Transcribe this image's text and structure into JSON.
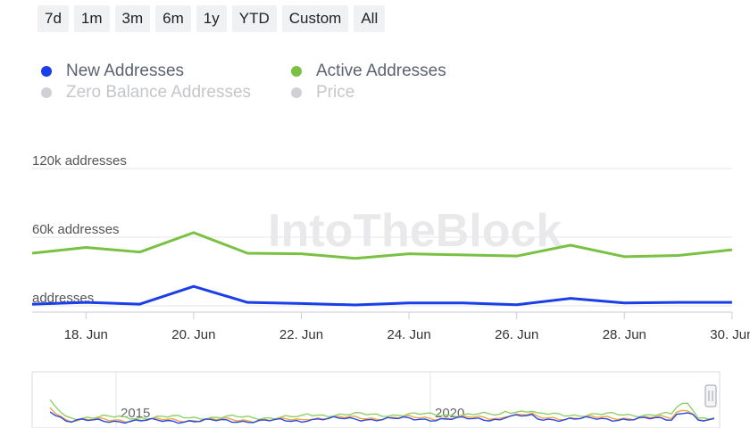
{
  "range_selector": {
    "buttons": [
      "7d",
      "1m",
      "3m",
      "6m",
      "1y",
      "YTD",
      "Custom",
      "All"
    ]
  },
  "legend": {
    "items": [
      {
        "label": "New Addresses",
        "color": "#1a3ee8",
        "active": true
      },
      {
        "label": "Active Addresses",
        "color": "#7ac143",
        "active": true
      },
      {
        "label": "Zero Balance Addresses",
        "color": "#cfd1d4",
        "active": false
      },
      {
        "label": "Price",
        "color": "#cfd1d4",
        "active": false
      }
    ]
  },
  "watermark": "IntoTheBlock",
  "chart_data": {
    "type": "line",
    "x": [
      "17. Jun",
      "18. Jun",
      "19. Jun",
      "20. Jun",
      "21. Jun",
      "22. Jun",
      "23. Jun",
      "24. Jun",
      "25. Jun",
      "26. Jun",
      "27. Jun",
      "28. Jun",
      "29. Jun",
      "30. Jun"
    ],
    "x_tick_labels": [
      "18. Jun",
      "20. Jun",
      "22. Jun",
      "24. Jun",
      "26. Jun",
      "28. Jun",
      "30. Jun"
    ],
    "y_tick_labels": [
      "addresses",
      "60k addresses",
      "120k addresses"
    ],
    "ylim": [
      0,
      120000
    ],
    "grid": true,
    "series": [
      {
        "name": "New Addresses",
        "color": "#1a3ee8",
        "values": [
          1500,
          3000,
          1500,
          17000,
          3000,
          2000,
          800,
          2500,
          2500,
          1000,
          6500,
          2500,
          3000,
          3000
        ]
      },
      {
        "name": "Active Addresses",
        "color": "#7ac143",
        "values": [
          46000,
          51000,
          47000,
          64000,
          46000,
          45500,
          41500,
          45500,
          44500,
          43500,
          53000,
          43000,
          44000,
          49000
        ]
      }
    ]
  },
  "navigator": {
    "labels": [
      "2015",
      "2020"
    ]
  }
}
